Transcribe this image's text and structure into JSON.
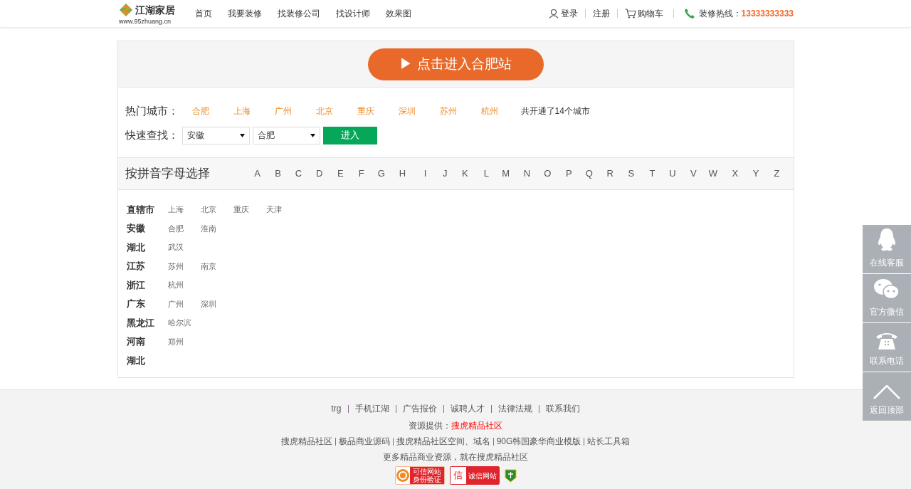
{
  "header": {
    "logo_text": "江湖家居",
    "logo_url": "www.95zhuang.cn",
    "nav": [
      "首页",
      "我要装修",
      "找装修公司",
      "找设计师",
      "效果图"
    ],
    "login": "登录",
    "register": "注册",
    "cart": "购物车",
    "hotline_label": "装修热线：",
    "hotline": "13333333333"
  },
  "enter_button": "▶ 点击进入合肥站",
  "hot_cities": {
    "label": "热门城市：",
    "cities": [
      "合肥",
      "上海",
      "广州",
      "北京",
      "重庆",
      "深圳",
      "苏州",
      "杭州"
    ],
    "summary": "共开通了14个城市"
  },
  "quick_find": {
    "label": "快速查找：",
    "province": "安徽",
    "city": "合肥",
    "button": "进入"
  },
  "pinyin": {
    "title": "按拼音字母选择",
    "letters": [
      "A",
      "B",
      "C",
      "D",
      "E",
      "F",
      "G",
      "H",
      "I",
      "J",
      "K",
      "L",
      "M",
      "N",
      "O",
      "P",
      "Q",
      "R",
      "S",
      "T",
      "U",
      "V",
      "W",
      "X",
      "Y",
      "Z"
    ]
  },
  "provinces": [
    {
      "name": "直辖市",
      "cities": [
        "上海",
        "北京",
        "重庆",
        "天津"
      ]
    },
    {
      "name": "安徽",
      "cities": [
        "合肥",
        "淮南"
      ]
    },
    {
      "name": "湖北",
      "cities": [
        "武汉"
      ]
    },
    {
      "name": "江苏",
      "cities": [
        "苏州",
        "南京"
      ]
    },
    {
      "name": "浙江",
      "cities": [
        "杭州"
      ]
    },
    {
      "name": "广东",
      "cities": [
        "广州",
        "深圳"
      ]
    },
    {
      "name": "黑龙江",
      "cities": [
        "哈尔滨"
      ]
    },
    {
      "name": "河南",
      "cities": [
        "郑州"
      ]
    },
    {
      "name": "湖北"
    }
  ],
  "footer": {
    "links": [
      "trg",
      "手机江湖",
      "广告报价",
      "诚聘人才",
      "法律法规",
      "联系我们"
    ],
    "source_label": "资源提供：",
    "source_link": "搜虎精品社区",
    "line_links": [
      "搜虎精品社区",
      "极品商业源码",
      "搜虎精品社区空间、域名",
      "90G韩国豪华商业模版",
      "站长工具箱"
    ],
    "slogan": "更多精品商业资源，就在搜虎精品社区",
    "badges": [
      {
        "kind": "trusted",
        "title": "可信网站",
        "subtitle": "身份验证"
      },
      {
        "kind": "credit",
        "mark": "信",
        "title": "诚信网站"
      },
      {
        "kind": "shield"
      }
    ]
  },
  "side_bar": [
    {
      "kind": "qq",
      "label": "在线客服"
    },
    {
      "kind": "wechat",
      "label": "官方微信"
    },
    {
      "kind": "phone",
      "label": "联系电话"
    },
    {
      "kind": "top",
      "label": "返回顶部"
    }
  ]
}
